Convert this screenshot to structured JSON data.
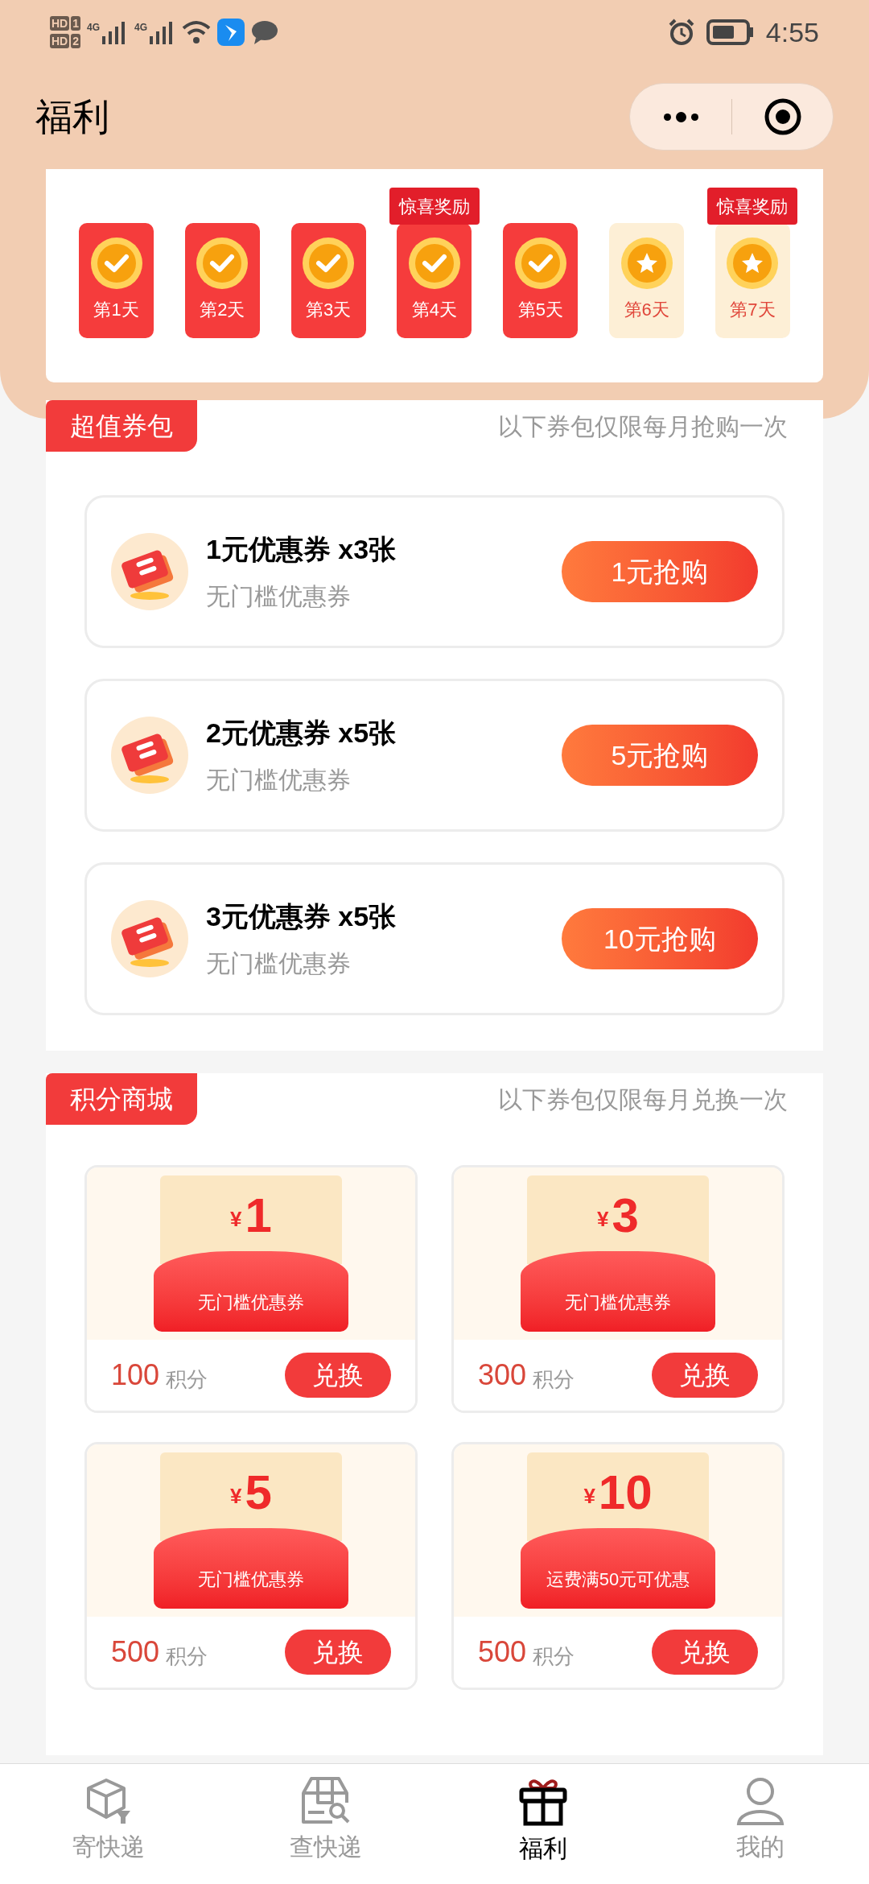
{
  "status_bar": {
    "sims": [
      {
        "label": "HD",
        "slot": "1",
        "network": "4G"
      },
      {
        "label": "HD",
        "slot": "2",
        "network": "4G"
      }
    ],
    "time": "4:55"
  },
  "header": {
    "title": "福利"
  },
  "checkin": {
    "days": [
      {
        "label": "第1天",
        "checked": true
      },
      {
        "label": "第2天",
        "checked": true
      },
      {
        "label": "第3天",
        "checked": true
      },
      {
        "label": "第4天",
        "checked": true,
        "badge": "惊喜奖励"
      },
      {
        "label": "第5天",
        "checked": true
      },
      {
        "label": "第6天",
        "checked": false
      },
      {
        "label": "第7天",
        "checked": false,
        "badge": "惊喜奖励"
      }
    ]
  },
  "coupon_packs": {
    "tag": "超值券包",
    "note": "以下券包仅限每月抢购一次",
    "items": [
      {
        "title": "1元优惠券 x3张",
        "subtitle": "无门槛优惠券",
        "button": "1元抢购"
      },
      {
        "title": "2元优惠券 x5张",
        "subtitle": "无门槛优惠券",
        "button": "5元抢购"
      },
      {
        "title": "3元优惠券 x5张",
        "subtitle": "无门槛优惠券",
        "button": "10元抢购"
      }
    ]
  },
  "points_mall": {
    "tag": "积分商城",
    "note": "以下券包仅限每月兑换一次",
    "items": [
      {
        "currency": "¥",
        "amount": "1",
        "desc": "无门槛优惠券",
        "points": "100",
        "unit": "积分",
        "button": "兑换"
      },
      {
        "currency": "¥",
        "amount": "3",
        "desc": "无门槛优惠券",
        "points": "300",
        "unit": "积分",
        "button": "兑换"
      },
      {
        "currency": "¥",
        "amount": "5",
        "desc": "无门槛优惠券",
        "points": "500",
        "unit": "积分",
        "button": "兑换"
      },
      {
        "currency": "¥",
        "amount": "10",
        "desc": "运费满50元可优惠",
        "points": "500",
        "unit": "积分",
        "button": "兑换"
      }
    ]
  },
  "tab_bar": [
    {
      "label": "寄快递",
      "kind": "send",
      "selected": false
    },
    {
      "label": "查快递",
      "kind": "track",
      "selected": false
    },
    {
      "label": "福利",
      "kind": "gift",
      "selected": true
    },
    {
      "label": "我的",
      "kind": "me",
      "selected": false
    }
  ]
}
